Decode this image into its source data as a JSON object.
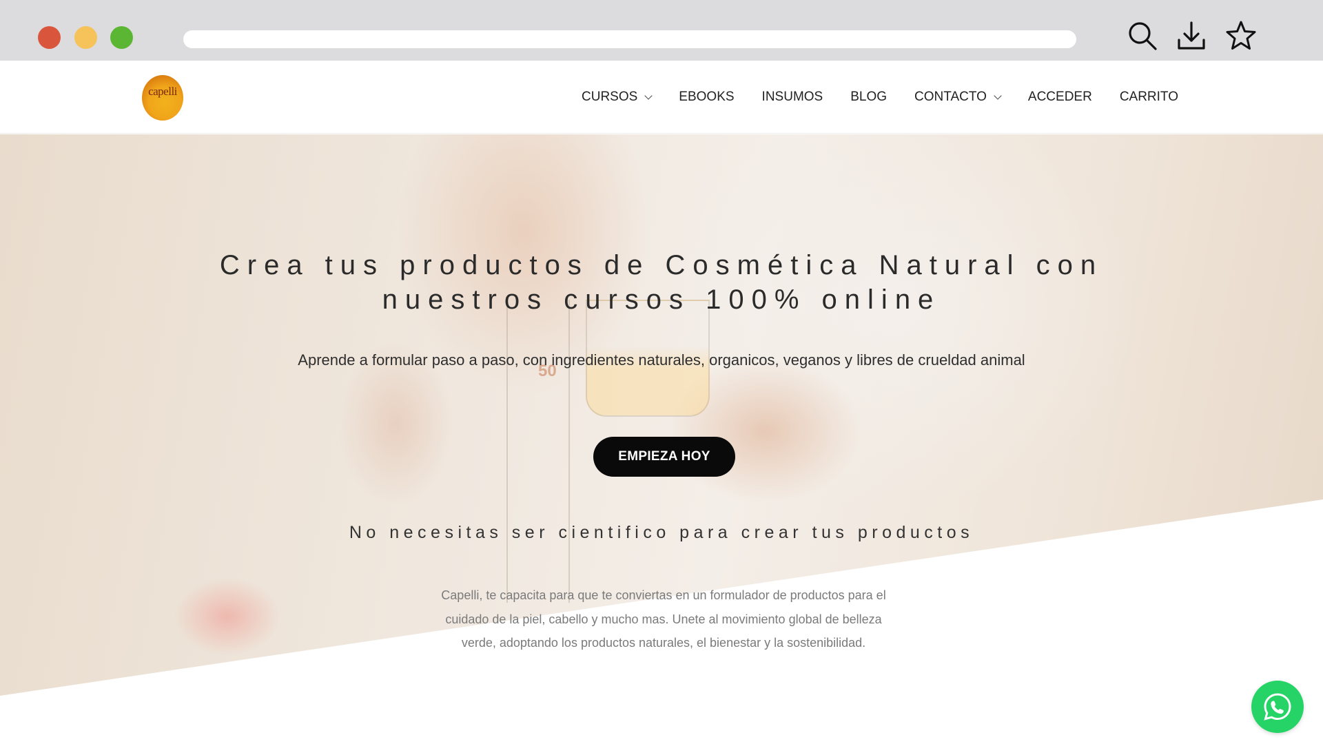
{
  "browser": {
    "window_controls": [
      "close",
      "minimize",
      "maximize"
    ],
    "url": "",
    "icons": [
      "search-icon",
      "download-icon",
      "star-icon"
    ]
  },
  "site": {
    "logo_text": "capelli",
    "nav": [
      {
        "label": "CURSOS",
        "dropdown": true
      },
      {
        "label": "EBOOKS",
        "dropdown": false
      },
      {
        "label": "INSUMOS",
        "dropdown": false
      },
      {
        "label": "BLOG",
        "dropdown": false
      },
      {
        "label": "CONTACTO",
        "dropdown": true
      },
      {
        "label": "ACCEDER",
        "dropdown": false
      },
      {
        "label": "CARRITO",
        "dropdown": false
      }
    ]
  },
  "hero": {
    "headline_line1": "Crea tus productos de Cosmética Natural con",
    "headline_line2": "nuestros cursos 100% online",
    "subheadline": "Aprende a formular paso a paso, con ingredientes naturales, organicos, veganos y libres de crueldad animal",
    "cta_label": "EMPIEZA HOY",
    "tagline": "No necesitas ser cientifico para crear tus productos",
    "body": "Capelli, te capacita para que te conviertas en un formulador de productos para el cuidado de la piel, cabello y mucho mas. Unete al movimiento global de belleza verde, adoptando los productos naturales, el bienestar y la sostenibilidad.",
    "tube_marking": "50"
  },
  "widgets": {
    "whatsapp_icon": "whatsapp-icon"
  },
  "colors": {
    "cta_bg": "#0a0a0a",
    "whatsapp": "#25d366",
    "chrome_bg": "#dcdcde"
  }
}
